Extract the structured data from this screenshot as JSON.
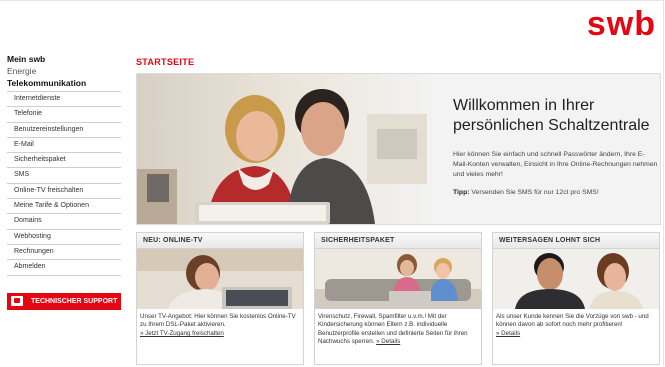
{
  "brand": {
    "logo_text": "swb",
    "accent_color": "#e30613"
  },
  "sidebar": {
    "top_items": [
      {
        "label": "Mein swb"
      },
      {
        "label": "Energie"
      },
      {
        "label": "Telekommunikation"
      }
    ],
    "sub_items": [
      {
        "label": "Internetdienste"
      },
      {
        "label": "Telefonie"
      },
      {
        "label": "Benutzereinstellungen"
      },
      {
        "label": "E-Mail"
      },
      {
        "label": "Sicherheitspaket"
      },
      {
        "label": "SMS"
      },
      {
        "label": "Online-TV freischalten"
      },
      {
        "label": "Meine Tarife & Optionen"
      },
      {
        "label": "Domains"
      },
      {
        "label": "Webhosting"
      },
      {
        "label": "Rechnungen"
      },
      {
        "label": "Abmelden"
      }
    ],
    "support": {
      "label": "TECHNISCHER SUPPORT",
      "icon": "phone-icon"
    }
  },
  "main": {
    "page_title": "STARTSEITE",
    "hero": {
      "heading": "Willkommen in Ihrer persönlichen Schaltzentrale",
      "body": "Hier können Sie einfach und schnell Passwörter ändern, Ihre E-Mail-Konten verwalten, Einsicht in Ihre Online-Rechnungen nehmen und vieles mehr!",
      "tip_label": "Tipp:",
      "tip_text": "Versenden Sie SMS für nur 12ct pro SMS!"
    },
    "teasers": [
      {
        "title": "NEU: ONLINE-TV",
        "text": "Unser TV-Angebot: Hier können Sie kostenlos Online-TV zu Ihrem DSL-Paket aktivieren.",
        "link": "» Jetzt TV-Zugang freischalten"
      },
      {
        "title": "SICHERHEITSPAKET",
        "text": "Virenschutz, Firewall, Spamfilter u.v.m.! Mit der Kindersicherung können Eltern z.B. individuelle Benutzerprofile erstellen und definierte Seiten für ihren Nachwuchs sperren.",
        "link": "» Details"
      },
      {
        "title": "WEITERSAGEN LOHNT SICH",
        "text": "Als unser Kunde kennen Sie die Vorzüge von swb - und können davon ab sofort noch mehr profitieren!",
        "link": "» Details"
      }
    ]
  }
}
